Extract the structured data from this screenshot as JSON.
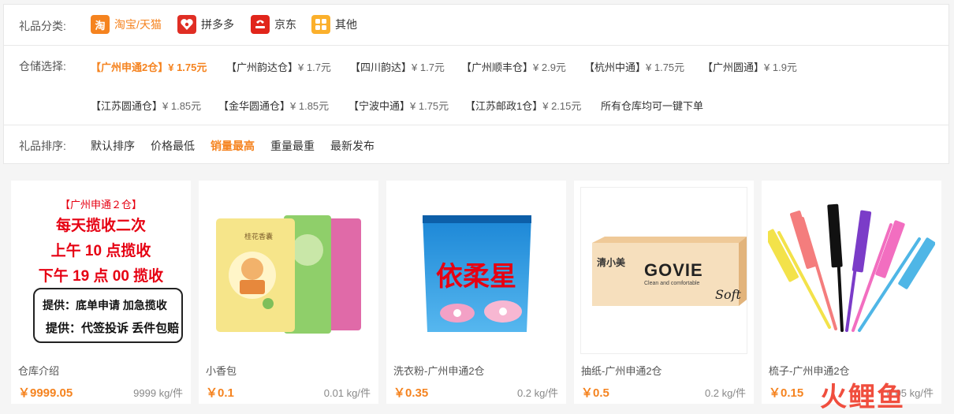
{
  "filters": {
    "category": {
      "label": "礼品分类:",
      "items": [
        {
          "label": "淘宝/天猫",
          "logo": "淘",
          "color": "#f5831f",
          "active": true
        },
        {
          "label": "拼多多",
          "logo": "拼",
          "color": "#e02e24",
          "active": false
        },
        {
          "label": "京东",
          "logo": "京",
          "color": "#e1251b",
          "active": false
        },
        {
          "label": "其他",
          "logo": "田",
          "color": "#fbb02c",
          "active": false
        }
      ]
    },
    "warehouse": {
      "label": "仓储选择:",
      "items": [
        {
          "name": "【广州申通2仓】",
          "price": "¥ 1.75元",
          "active": true
        },
        {
          "name": "【广州韵达仓】",
          "price": "¥ 1.7元",
          "active": false
        },
        {
          "name": "【四川韵达】",
          "price": "¥ 1.7元",
          "active": false
        },
        {
          "name": "【广州顺丰仓】",
          "price": "¥ 2.9元",
          "active": false
        },
        {
          "name": "【杭州中通】",
          "price": "¥ 1.75元",
          "active": false
        },
        {
          "name": "【广州圆通】",
          "price": "¥ 1.9元",
          "active": false
        },
        {
          "name": "【江苏圆通仓】",
          "price": "¥ 1.85元",
          "active": false
        },
        {
          "name": "【金华圆通仓】",
          "price": "¥ 1.85元",
          "active": false
        },
        {
          "name": "【宁波中通】",
          "price": "¥ 1.75元",
          "active": false
        },
        {
          "name": "【江苏邮政1仓】",
          "price": "¥ 2.15元",
          "active": false
        }
      ],
      "note": "所有仓库均可一键下单"
    },
    "sort": {
      "label": "礼品排序:",
      "items": [
        {
          "label": "默认排序",
          "active": false
        },
        {
          "label": "价格最低",
          "active": false
        },
        {
          "label": "销量最高",
          "active": true
        },
        {
          "label": "重量最重",
          "active": false
        },
        {
          "label": "最新发布",
          "active": false
        }
      ]
    }
  },
  "products": [
    {
      "name": "仓库介绍",
      "price": "￥9999.05",
      "weight": "9999 kg/件",
      "poster": {
        "title": "【广州申通２仓】",
        "lines": [
          "每天揽收二次",
          "上午 10 点揽收",
          "下午 19 点 00 揽收"
        ],
        "box": [
          "提供：底单申请  加急揽收",
          "提供：代签投诉  丢件包赔"
        ]
      }
    },
    {
      "name": "小香包",
      "price": "￥0.1",
      "weight": "0.01 kg/件",
      "image": "sachet-image"
    },
    {
      "name": "洗衣粉-广州申通2仓",
      "price": "￥0.35",
      "weight": "0.2 kg/件",
      "image": "detergent-image",
      "brand": "依柔星"
    },
    {
      "name": "抽纸-广州申通2仓",
      "price": "￥0.5",
      "weight": "0.2 kg/件",
      "image": "tissue-image",
      "brand": "GOVIE",
      "brand_sub": "Clean and comfortable",
      "brand_script": "Soft",
      "brand_cn": "清小美"
    },
    {
      "name": "梳子-广州申通2仓",
      "price": "￥0.15",
      "weight": "0.05 kg/件",
      "image": "comb-image"
    }
  ],
  "watermark": "火鲤鱼",
  "colors": {
    "accent": "#f5831f",
    "poster_red": "#e60012"
  }
}
